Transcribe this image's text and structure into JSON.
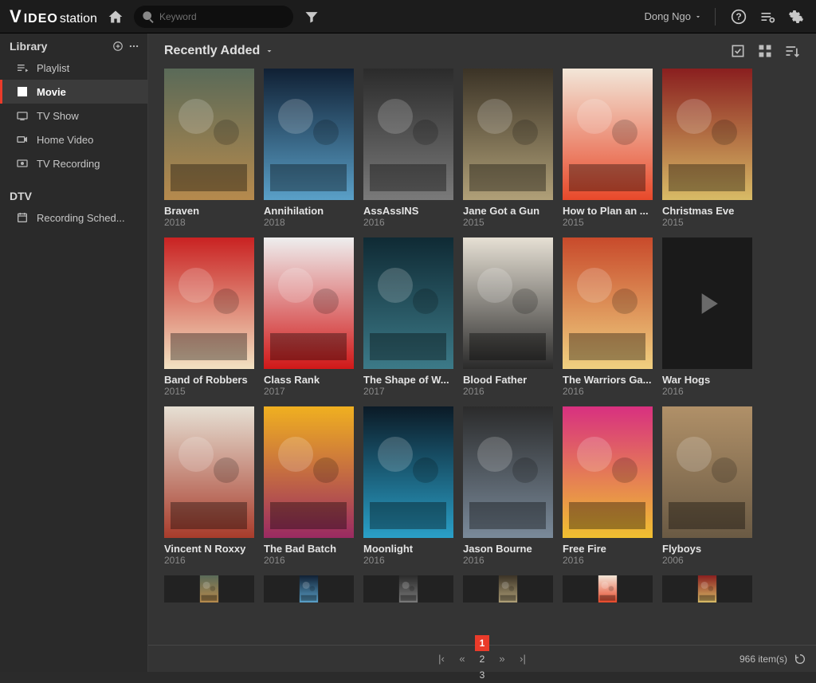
{
  "app": {
    "logo_prefix": "V",
    "logo_mid": "IDEO",
    "logo_suffix": "station"
  },
  "search": {
    "placeholder": "Keyword"
  },
  "user": {
    "name": "Dong Ngo"
  },
  "sidebar": {
    "sections": [
      {
        "label": "Library",
        "items": [
          {
            "label": "Playlist",
            "icon": "playlist-icon",
            "active": false
          },
          {
            "label": "Movie",
            "icon": "movie-icon",
            "active": true
          },
          {
            "label": "TV Show",
            "icon": "tvshow-icon",
            "active": false
          },
          {
            "label": "Home Video",
            "icon": "homevideo-icon",
            "active": false
          },
          {
            "label": "TV Recording",
            "icon": "tvrec-icon",
            "active": false
          }
        ]
      },
      {
        "label": "DTV",
        "items": [
          {
            "label": "Recording Sched...",
            "icon": "calendar-icon",
            "active": false
          }
        ]
      }
    ]
  },
  "toolbar": {
    "sort_label": "Recently Added"
  },
  "movies": [
    {
      "title": "Braven",
      "year": "2018"
    },
    {
      "title": "Annihilation",
      "year": "2018"
    },
    {
      "title": "AssAssINS",
      "year": "2016"
    },
    {
      "title": "Jane Got a Gun",
      "year": "2015"
    },
    {
      "title": "How to Plan an ...",
      "year": "2015"
    },
    {
      "title": "Christmas Eve",
      "year": "2015"
    },
    {
      "title": "Band of Robbers",
      "year": "2015"
    },
    {
      "title": "Class Rank",
      "year": "2017"
    },
    {
      "title": "The Shape of W...",
      "year": "2017"
    },
    {
      "title": "Blood Father",
      "year": "2016"
    },
    {
      "title": "The Warriors Ga...",
      "year": "2016"
    },
    {
      "title": "War Hogs",
      "year": "2016",
      "no_poster": true
    },
    {
      "title": "Vincent N Roxxy",
      "year": "2016"
    },
    {
      "title": "The Bad Batch",
      "year": "2016"
    },
    {
      "title": "Moonlight",
      "year": "2016"
    },
    {
      "title": "Jason Bourne",
      "year": "2016"
    },
    {
      "title": "Free Fire",
      "year": "2016"
    },
    {
      "title": "Flyboys",
      "year": "2006"
    }
  ],
  "pager": {
    "pages": [
      "1",
      "2",
      "3"
    ],
    "active": 0,
    "total_label": "966 item(s)"
  },
  "colors": {
    "accent": "#ea3b2a"
  }
}
